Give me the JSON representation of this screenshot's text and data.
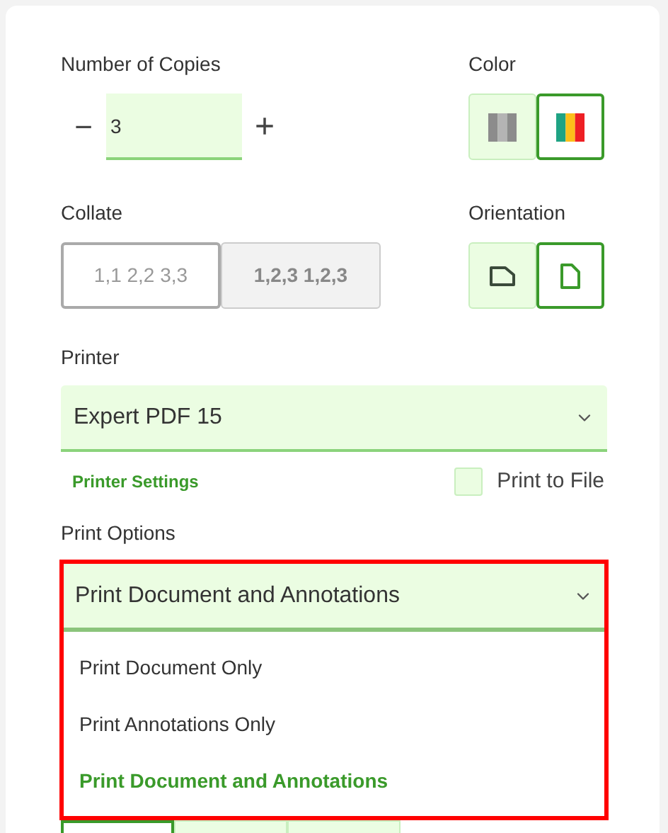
{
  "copies": {
    "label": "Number of Copies",
    "minus": "−",
    "value": "3",
    "plus": "+"
  },
  "color": {
    "label": "Color",
    "options": [
      {
        "kind": "grayscale",
        "selected": false
      },
      {
        "kind": "color",
        "selected": true
      }
    ]
  },
  "collate": {
    "label": "Collate",
    "options": [
      {
        "label": "1,1 2,2 3,3",
        "selected": true
      },
      {
        "label": "1,2,3 1,2,3",
        "selected": false
      }
    ]
  },
  "orientation": {
    "label": "Orientation",
    "options": [
      {
        "kind": "landscape",
        "selected": false
      },
      {
        "kind": "portrait",
        "selected": true
      }
    ]
  },
  "printer": {
    "label": "Printer",
    "value": "Expert PDF 15"
  },
  "printer_settings": "Printer Settings",
  "print_to_file": {
    "label": "Print to File",
    "checked": false
  },
  "print_options": {
    "label": "Print Options",
    "value": "Print Document and Annotations",
    "expanded": true,
    "highlighted": true,
    "options": [
      {
        "label": "Print Document Only",
        "selected": false
      },
      {
        "label": "Print Annotations Only",
        "selected": false
      },
      {
        "label": "Print Document and Annotations",
        "selected": true
      }
    ]
  },
  "bottom_group": {
    "options": [
      {
        "selected": true
      },
      {
        "selected": false
      },
      {
        "selected": false
      }
    ]
  }
}
